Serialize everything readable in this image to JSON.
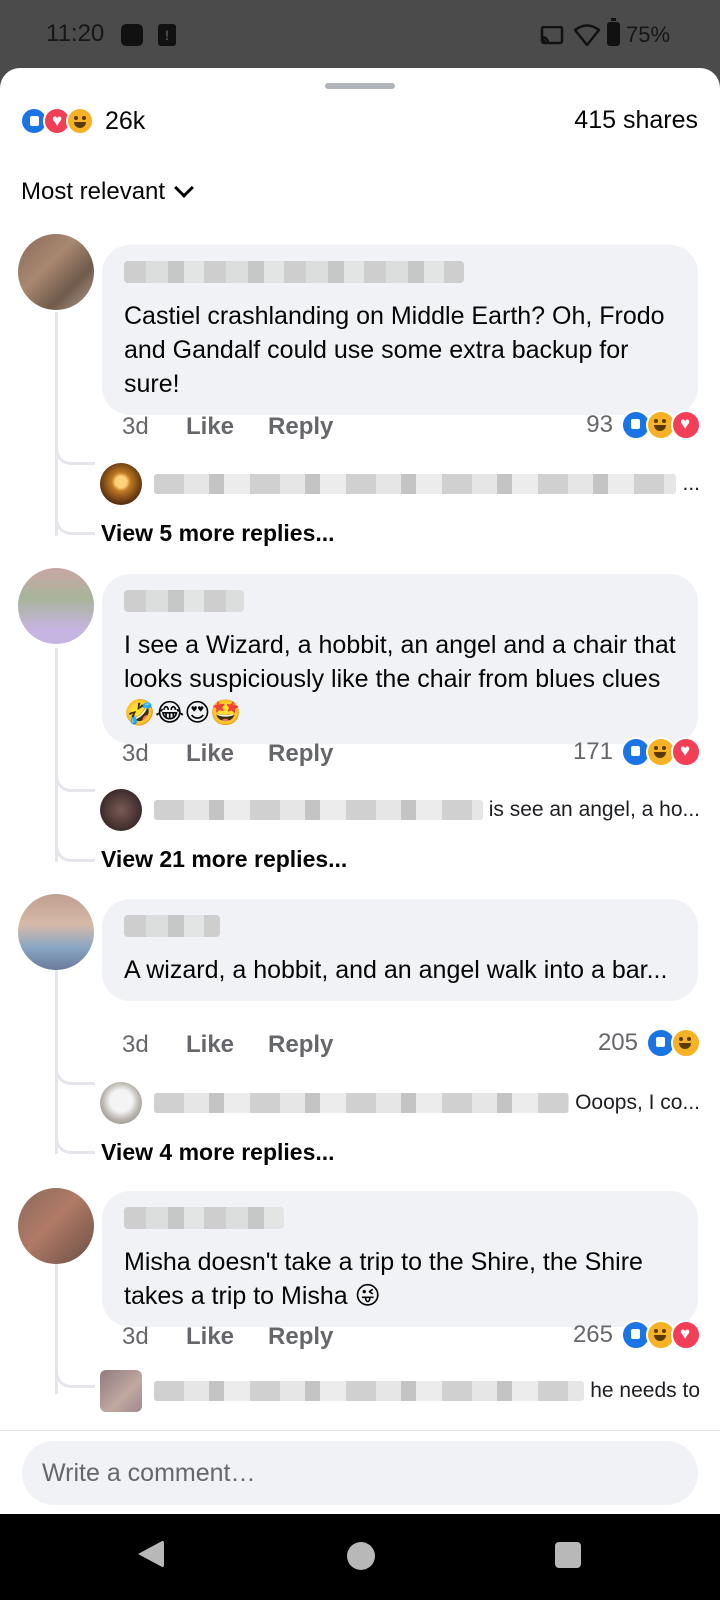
{
  "status_bar": {
    "time": "11:20",
    "battery": "75%"
  },
  "post_stats": {
    "reactions": "26k",
    "shares": "415 shares"
  },
  "sort": {
    "label": "Most relevant"
  },
  "actions": {
    "like": "Like",
    "reply": "Reply"
  },
  "comments": [
    {
      "text": "Castiel crashlanding on Middle Earth? Oh, Frodo and Gandalf could use some extra backup for sure!",
      "age": "3d",
      "reaction_count": "93",
      "reply_preview": "...",
      "view_more": "View 5 more replies..."
    },
    {
      "text": "I see a Wizard, a hobbit, an angel and a chair that looks suspiciously like the chair from blues clues 🤣😂😍🤩",
      "age": "3d",
      "reaction_count": "171",
      "reply_preview": "is see an angel, a ho...",
      "view_more": "View 21 more replies..."
    },
    {
      "text": "A wizard, a hobbit, and an angel walk into a bar...",
      "age": "3d",
      "reaction_count": "205",
      "reply_preview": "Ooops, I co...",
      "view_more": "View 4 more replies..."
    },
    {
      "text": "Misha doesn't take a trip to the Shire, the Shire takes a trip to Misha 😜",
      "age": "3d",
      "reaction_count": "265",
      "reply_preview": "he needs to"
    }
  ],
  "composer": {
    "placeholder": "Write a comment…"
  },
  "colors": {
    "like": "#1b74e4",
    "love": "#f33e58",
    "haha": "#f7b125",
    "bubble": "#f0f2f5"
  }
}
